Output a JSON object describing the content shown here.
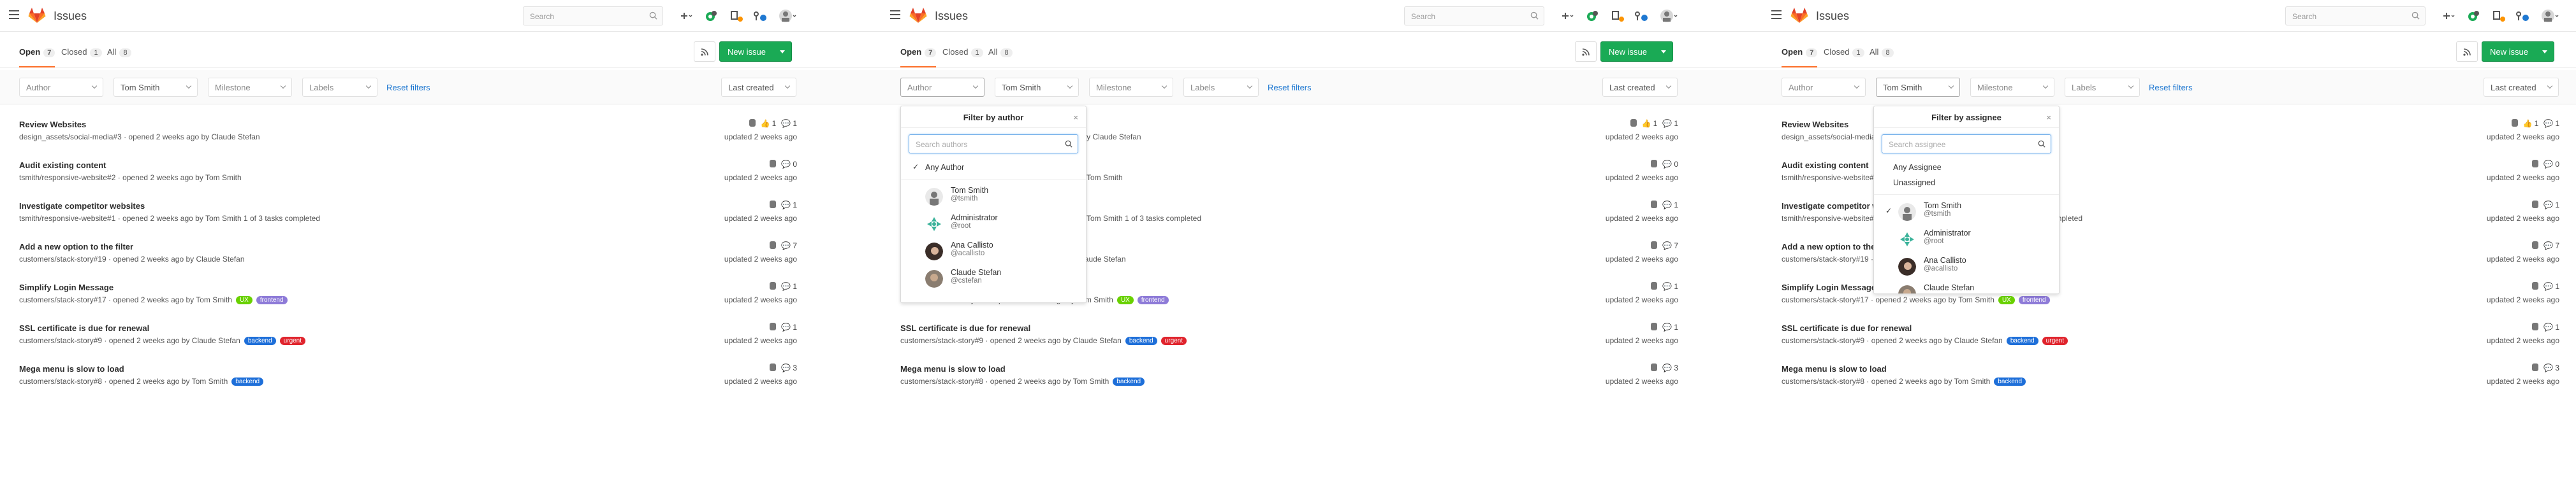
{
  "app": {
    "title": "Issues",
    "search_placeholder": "Search"
  },
  "tabs": [
    {
      "label": "Open",
      "count": "7"
    },
    {
      "label": "Closed",
      "count": "1"
    },
    {
      "label": "All",
      "count": "8"
    }
  ],
  "actions": {
    "new_issue": "New issue"
  },
  "filters": {
    "author": "Author",
    "assignee": "Tom Smith",
    "milestone": "Milestone",
    "labels": "Labels",
    "reset": "Reset filters",
    "sort": "Last created"
  },
  "issues": [
    {
      "title": "Review Websites",
      "meta": "design_assets/social-media#3 · opened 2 weeks ago by Claude Stefan",
      "updated": "updated 2 weeks ago",
      "likes": "1",
      "comments": "1",
      "labels": []
    },
    {
      "title": "Audit existing content",
      "meta": "tsmith/responsive-website#2 · opened 2 weeks ago by Tom Smith",
      "updated": "updated 2 weeks ago",
      "likes": "",
      "comments": "0",
      "labels": []
    },
    {
      "title": "Investigate competitor websites",
      "meta": "tsmith/responsive-website#1 · opened 2 weeks ago by Tom Smith   1 of 3 tasks completed",
      "updated": "updated 2 weeks ago",
      "likes": "",
      "comments": "1",
      "labels": []
    },
    {
      "title": "Add a new option to the filter",
      "meta": "customers/stack-story#19 · opened 2 weeks ago by Claude Stefan",
      "updated": "updated 2 weeks ago",
      "likes": "",
      "comments": "7",
      "labels": []
    },
    {
      "title": "Simplify Login Message",
      "meta": "customers/stack-story#17 · opened 2 weeks ago by Tom Smith",
      "updated": "updated 2 weeks ago",
      "likes": "",
      "comments": "1",
      "labels": [
        {
          "text": "UX",
          "color": "#69d100"
        },
        {
          "text": "frontend",
          "color": "#8e7bd8"
        }
      ]
    },
    {
      "title": "SSL certificate is due for renewal",
      "meta": "customers/stack-story#9 · opened 2 weeks ago by Claude Stefan",
      "updated": "updated 2 weeks ago",
      "likes": "",
      "comments": "1",
      "labels": [
        {
          "text": "backend",
          "color": "#1e6fd9"
        },
        {
          "text": "urgent",
          "color": "#e0242d"
        }
      ]
    },
    {
      "title": "Mega menu is slow to load",
      "meta": "customers/stack-story#8 · opened 2 weeks ago by Tom Smith",
      "updated": "updated 2 weeks ago",
      "likes": "",
      "comments": "3",
      "labels": [
        {
          "text": "backend",
          "color": "#1e6fd9"
        }
      ]
    }
  ],
  "author_dropdown": {
    "title": "Filter by author",
    "close": "×",
    "search_placeholder": "Search authors",
    "any": "Any Author",
    "users": [
      {
        "name": "Tom Smith",
        "username": "@tsmith"
      },
      {
        "name": "Administrator",
        "username": "@root"
      },
      {
        "name": "Ana Callisto",
        "username": "@acallisto"
      },
      {
        "name": "Claude Stefan",
        "username": "@cstefan"
      }
    ]
  },
  "assignee_dropdown": {
    "title": "Filter by assignee",
    "close": "×",
    "search_placeholder": "Search assignee",
    "any": "Any Assignee",
    "unassigned": "Unassigned",
    "users": [
      {
        "name": "Tom Smith",
        "username": "@tsmith"
      },
      {
        "name": "Administrator",
        "username": "@root"
      },
      {
        "name": "Ana Callisto",
        "username": "@acallisto"
      },
      {
        "name": "Claude Stefan",
        "username": ""
      }
    ]
  },
  "colors": {
    "brand_orange": "#fc6d26",
    "new_issue_green": "#1aaa55",
    "link_blue": "#1f78d1"
  },
  "icons": [
    "hamburger-icon",
    "gitlab-logo",
    "search-icon",
    "plus-icon",
    "todo-icon",
    "issues-icon",
    "merge-request-icon",
    "user-avatar-icon",
    "rss-icon",
    "thumbs-up-icon",
    "comment-icon",
    "check-icon"
  ]
}
